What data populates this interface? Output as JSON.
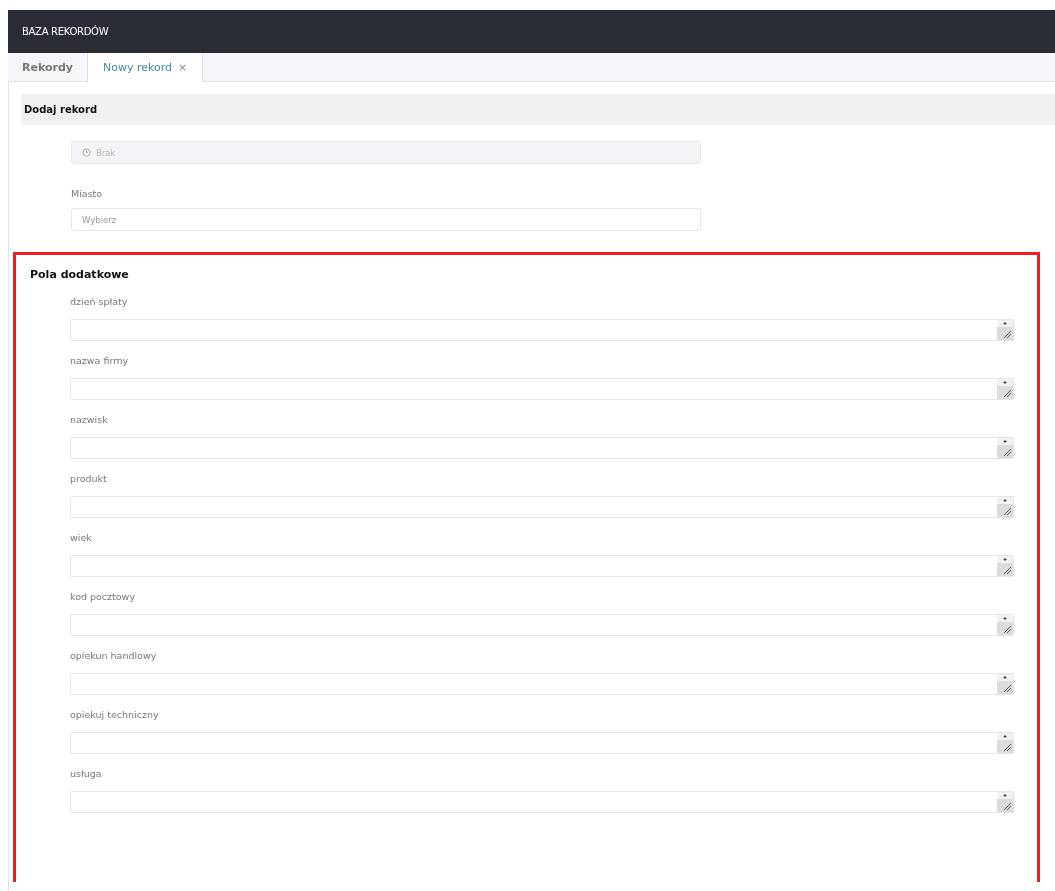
{
  "app_bar": {
    "title": "BAZA REKORDÓW"
  },
  "tabs": [
    {
      "label": "Rekordy",
      "selected": false
    },
    {
      "label": "Nowy rekord",
      "selected": true,
      "close_glyph": "×"
    }
  ],
  "form": {
    "title": "Dodaj rekord",
    "fields": [
      {
        "kind": "date",
        "placeholder": "Brak",
        "disabled": true
      },
      {
        "kind": "select",
        "label": "Miasto",
        "placeholder": "Wybierz",
        "disabled": false
      }
    ]
  },
  "extra_fields": {
    "title": "Pola dodatkowe",
    "highlighted": true,
    "fields": [
      {
        "label": "dzień spłaty"
      },
      {
        "label": "nazwa firmy"
      },
      {
        "label": "nazwisk"
      },
      {
        "label": "produkt"
      },
      {
        "label": "wiek"
      },
      {
        "label": "kod pocztowy"
      },
      {
        "label": "opiekun handlowy"
      },
      {
        "label": "opiekuj techniczny"
      },
      {
        "label": "usługa"
      }
    ]
  }
}
